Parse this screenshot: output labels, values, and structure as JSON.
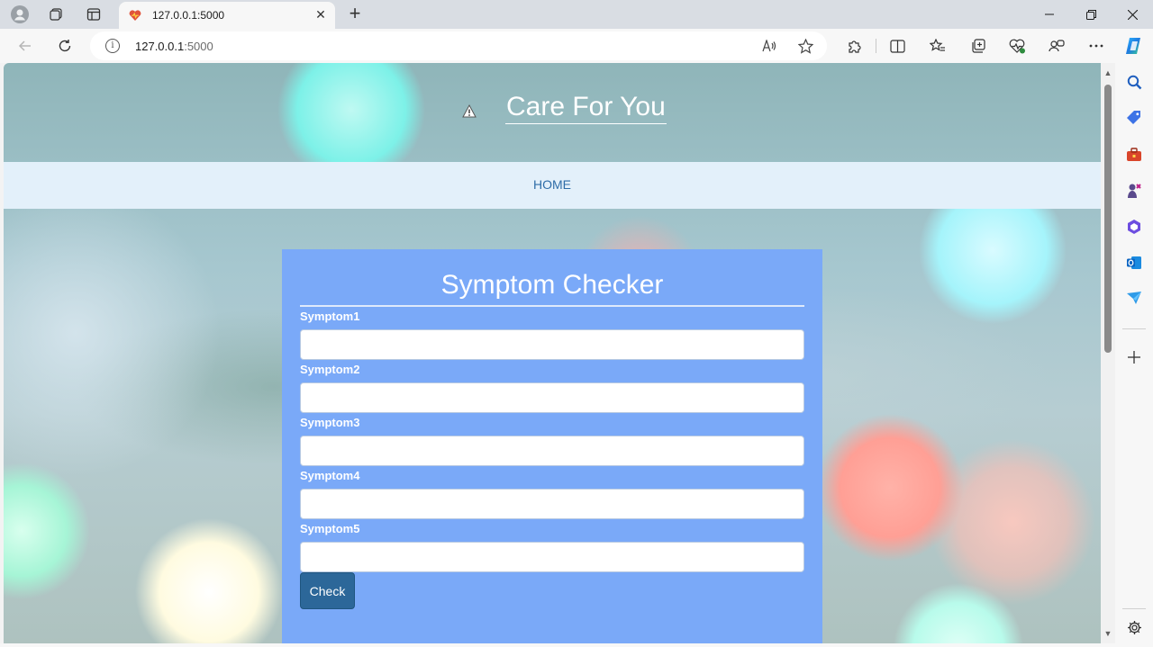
{
  "browser": {
    "tab": {
      "title": "127.0.0.1:5000",
      "favicon": "heart-favicon-icon",
      "close_label": "✕"
    },
    "new_tab_label": "+",
    "window_controls": {
      "minimize": "—",
      "restore": "❐",
      "close": "✕"
    },
    "address": {
      "host": "127.0.0.1",
      "port": ":5000"
    },
    "toolbar_icons": [
      "back-icon",
      "refresh-icon",
      "read-aloud-icon",
      "favorite-star-icon",
      "extensions-icon",
      "split-screen-icon",
      "favorites-icon",
      "collections-icon",
      "browser-essentials-icon",
      "copilot-icon",
      "more-icon"
    ],
    "sidebar_icons": [
      "search-icon",
      "shopping-tag-icon",
      "tools-briefcase-icon",
      "games-icon",
      "microsoft365-icon",
      "outlook-icon",
      "drop-icon",
      "add-icon",
      "settings-icon"
    ]
  },
  "site": {
    "title": "Care For You",
    "logo_icon": "broken-image-icon",
    "nav": {
      "home": "HOME"
    }
  },
  "form": {
    "title": "Symptom Checker",
    "fields": [
      {
        "label": "Symptom1",
        "value": "",
        "placeholder": ""
      },
      {
        "label": "Symptom2",
        "value": "",
        "placeholder": ""
      },
      {
        "label": "Symptom3",
        "value": "",
        "placeholder": ""
      },
      {
        "label": "Symptom4",
        "value": "",
        "placeholder": ""
      },
      {
        "label": "Symptom5",
        "value": "",
        "placeholder": ""
      }
    ],
    "submit_label": "Check"
  },
  "colors": {
    "form_background": "#7aa9f8",
    "navbar_background": "#e3f0fa",
    "nav_link": "#2f6da8",
    "button": "#2c6799"
  }
}
